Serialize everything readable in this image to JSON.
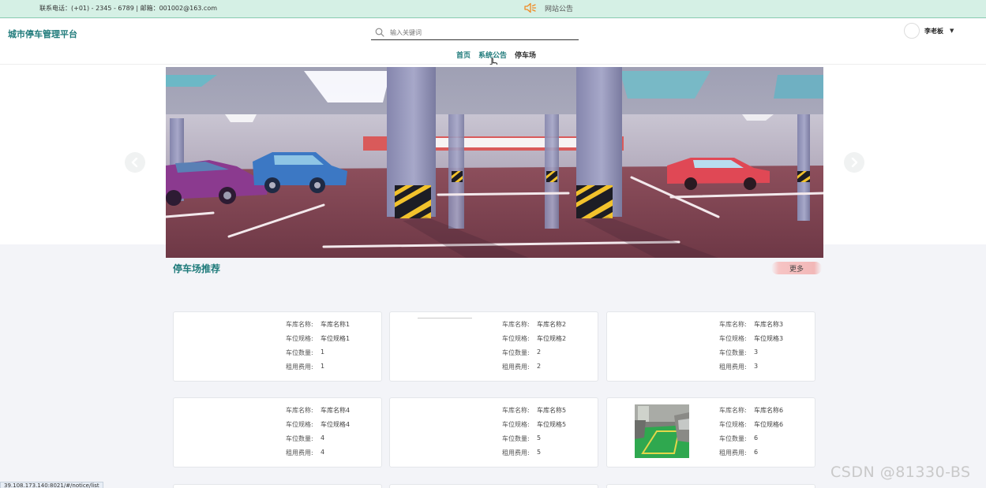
{
  "topbar": {
    "contact": "联系电话：(+01) - 2345 - 6789 | 邮箱：001002@163.com",
    "notice_label": "网站公告"
  },
  "header": {
    "logo": "城市停车管理平台",
    "search_placeholder": "输入关键词",
    "nav": [
      "首页",
      "系统公告",
      "停车场"
    ],
    "user_name": "李老板"
  },
  "section": {
    "title": "停车场推荐",
    "more_label": "更多"
  },
  "labels": {
    "name": "车库名称:",
    "spec": "车位规格:",
    "count": "车位数量:",
    "fee": "租用费用:"
  },
  "cards": [
    {
      "name": "车库名称1",
      "spec": "车位规格1",
      "count": "1",
      "fee": "1"
    },
    {
      "name": "车库名称2",
      "spec": "车位规格2",
      "count": "2",
      "fee": "2"
    },
    {
      "name": "车库名称3",
      "spec": "车位规格3",
      "count": "3",
      "fee": "3"
    },
    {
      "name": "车库名称4",
      "spec": "车位规格4",
      "count": "4",
      "fee": "4"
    },
    {
      "name": "车库名称5",
      "spec": "车位规格5",
      "count": "5",
      "fee": "5"
    },
    {
      "name": "车库名称6",
      "spec": "车位规格6",
      "count": "6",
      "fee": "6"
    }
  ],
  "status_url": "39.108.173.140:8021/#/notice/list",
  "watermark": "CSDN @81330-BS",
  "colors": {
    "accent": "#1e7a7a",
    "topbar_bg": "#d5f0e5",
    "more_btn": "#f2b8b8"
  }
}
